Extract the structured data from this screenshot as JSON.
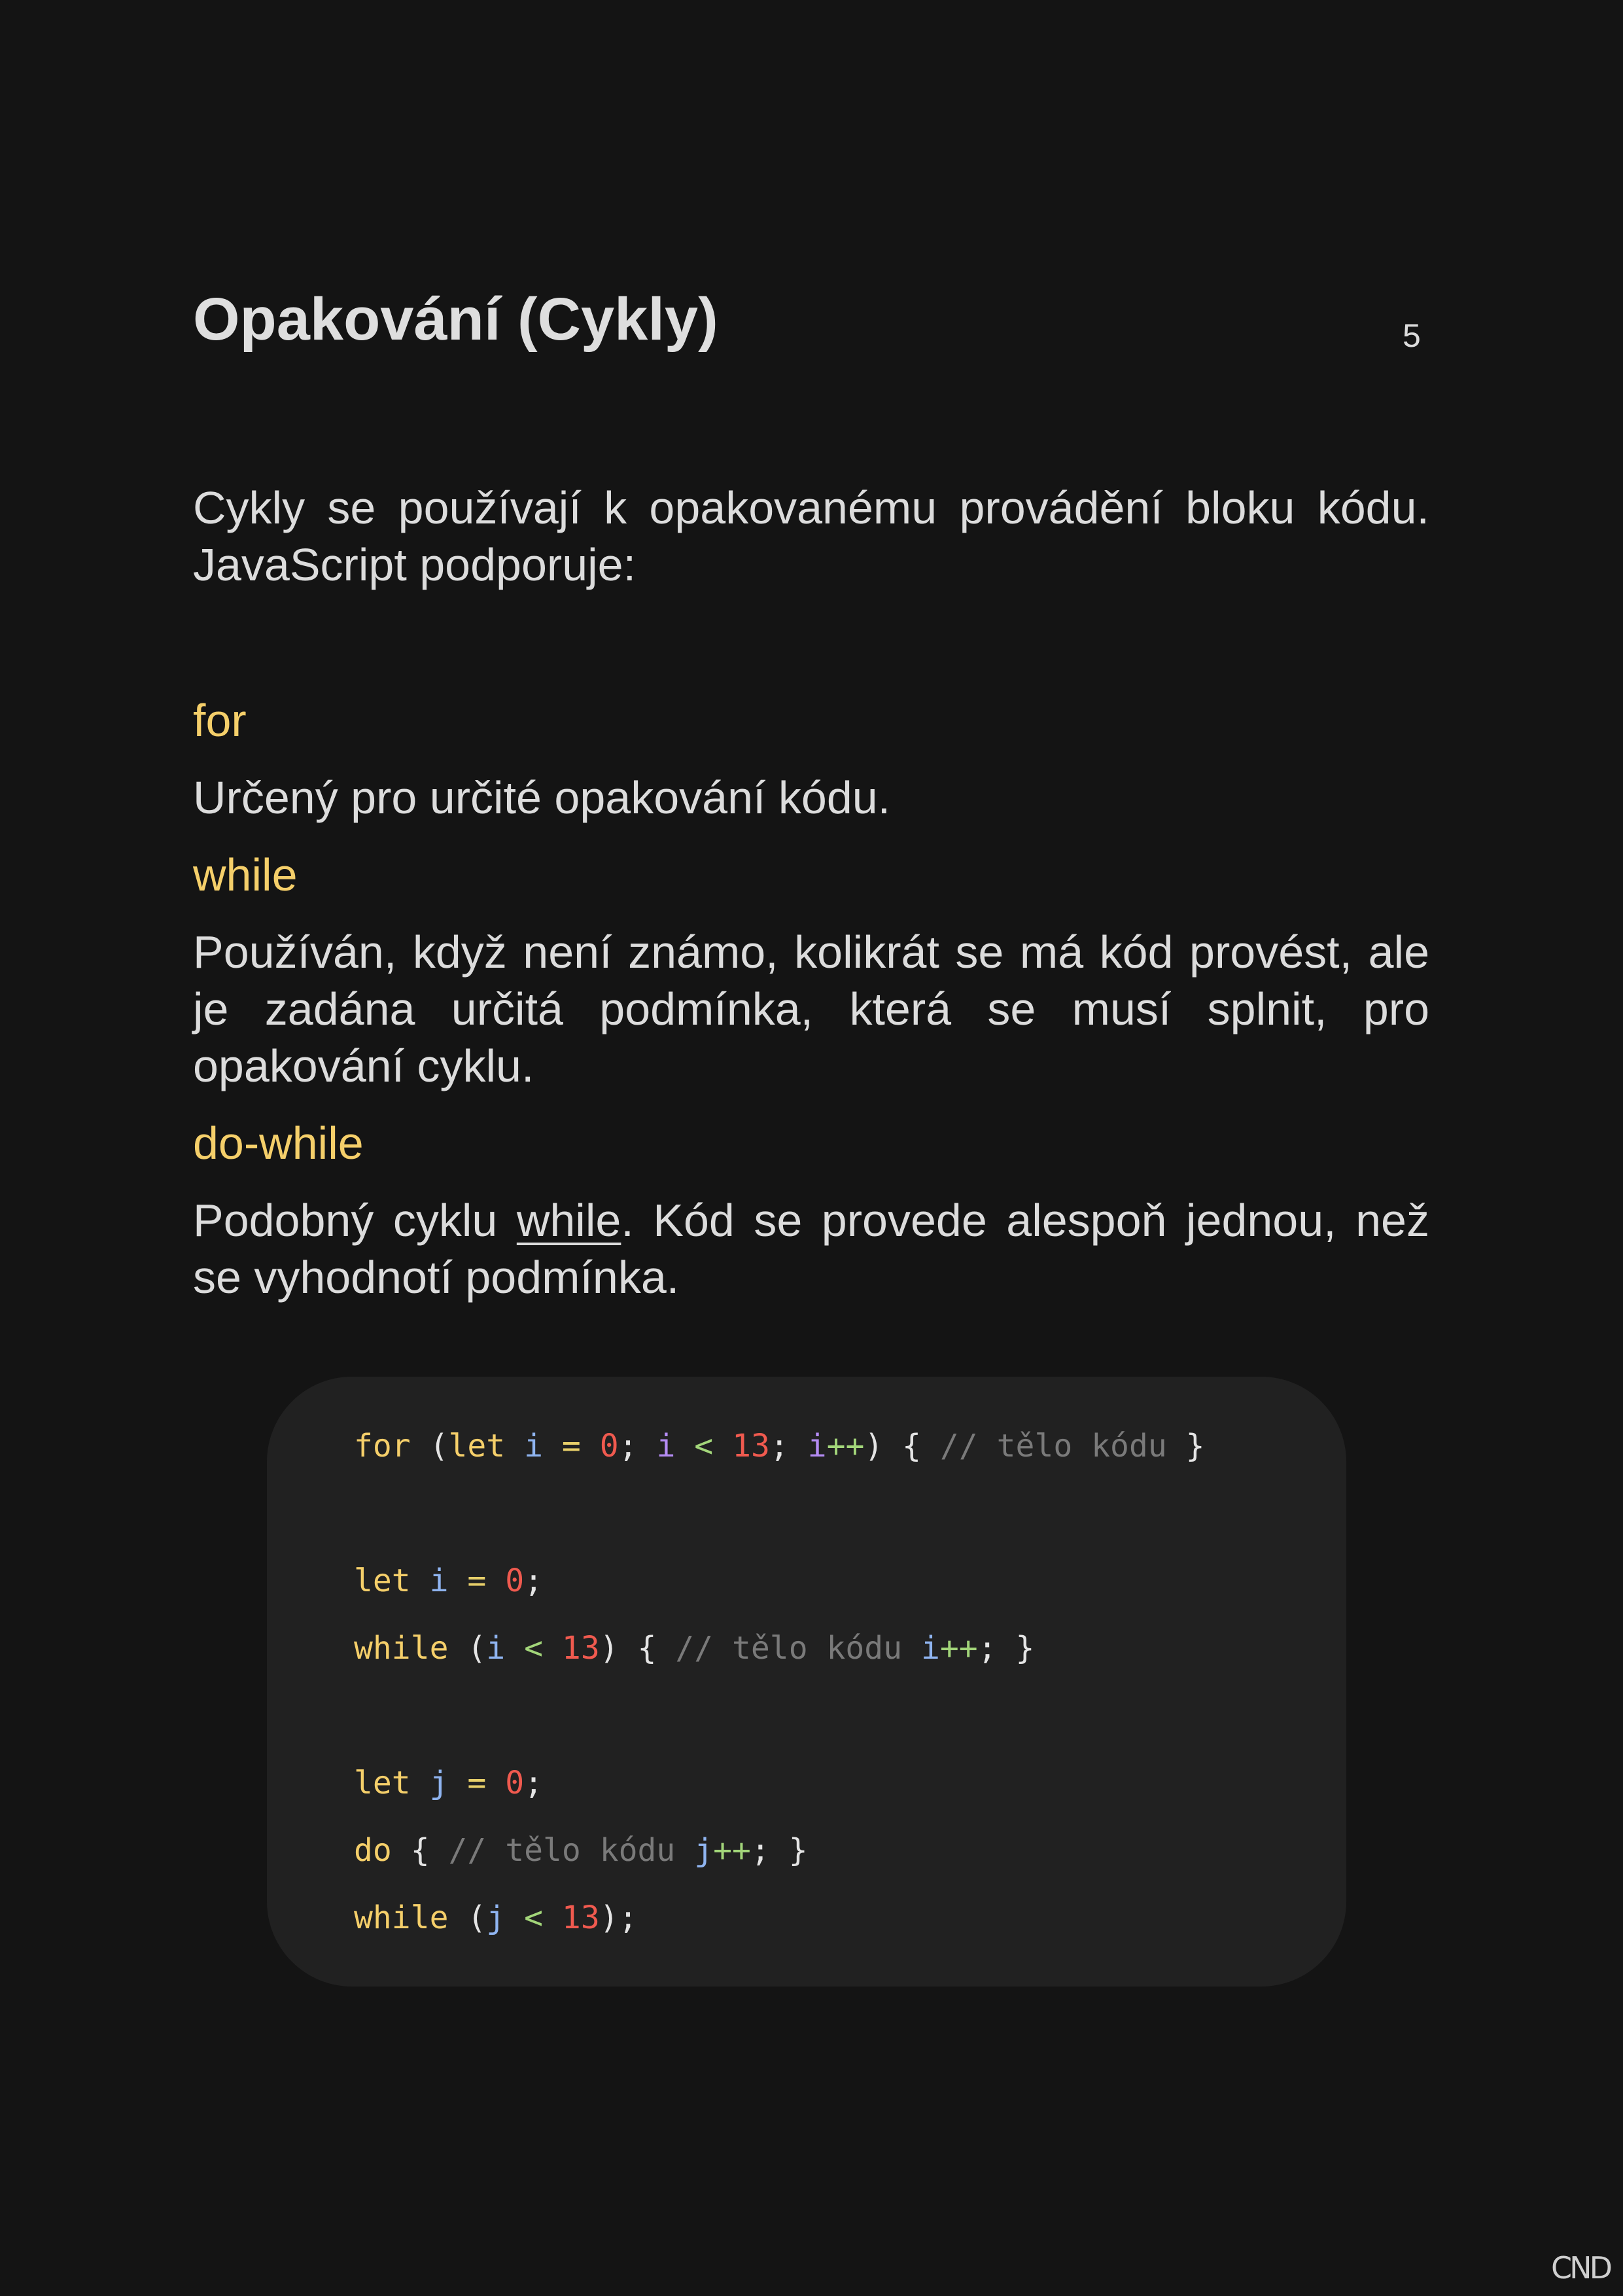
{
  "header": {
    "title": "Opakování (Cykly)",
    "page_number": "5"
  },
  "intro": "Cykly se používají k opakovanému provádění bloku kódu. JavaScript podporuje:",
  "loops": [
    {
      "term": "for",
      "description": "Určený pro určité opakování kódu."
    },
    {
      "term": "while",
      "description": "Používán, když není známo, kolikrát se má kód provést, ale je zadána určitá podmínka, která se musí splnit, pro opakování cyklu."
    },
    {
      "term": "do-while",
      "description_before": "Podobný cyklu ",
      "description_link": "while",
      "description_after": ". Kód se provede alespoň jednou, než se vyhodnotí podmínka."
    }
  ],
  "code": {
    "lines": [
      [
        [
          "kw",
          "for"
        ],
        [
          "pl",
          " ("
        ],
        [
          "kw",
          "let"
        ],
        [
          "pl",
          " "
        ],
        [
          "var",
          "i"
        ],
        [
          "pl",
          " "
        ],
        [
          "op",
          "="
        ],
        [
          "pl",
          " "
        ],
        [
          "num",
          "0"
        ],
        [
          "pl",
          "; "
        ],
        [
          "var2",
          "i"
        ],
        [
          "pl",
          " "
        ],
        [
          "opg",
          "<"
        ],
        [
          "pl",
          " "
        ],
        [
          "num",
          "13"
        ],
        [
          "pl",
          "; "
        ],
        [
          "var2",
          "i"
        ],
        [
          "opg",
          "++"
        ],
        [
          "pl",
          ") { "
        ],
        [
          "cmt",
          "// tělo kódu"
        ],
        [
          "pl",
          " }"
        ]
      ],
      [],
      [
        [
          "kw",
          "let"
        ],
        [
          "pl",
          " "
        ],
        [
          "var",
          "i"
        ],
        [
          "pl",
          " "
        ],
        [
          "op",
          "="
        ],
        [
          "pl",
          " "
        ],
        [
          "num",
          "0"
        ],
        [
          "pl",
          ";"
        ]
      ],
      [
        [
          "kw",
          "while"
        ],
        [
          "pl",
          " ("
        ],
        [
          "var",
          "i"
        ],
        [
          "pl",
          " "
        ],
        [
          "opg",
          "<"
        ],
        [
          "pl",
          " "
        ],
        [
          "num",
          "13"
        ],
        [
          "pl",
          ") { "
        ],
        [
          "cmt",
          "// tělo kódu"
        ],
        [
          "pl",
          " "
        ],
        [
          "var",
          "i"
        ],
        [
          "opg",
          "++"
        ],
        [
          "pl",
          "; }"
        ]
      ],
      [],
      [
        [
          "kw",
          "let"
        ],
        [
          "pl",
          " "
        ],
        [
          "var",
          "j"
        ],
        [
          "pl",
          " "
        ],
        [
          "op",
          "="
        ],
        [
          "pl",
          " "
        ],
        [
          "num",
          "0"
        ],
        [
          "pl",
          ";"
        ]
      ],
      [
        [
          "kw",
          "do"
        ],
        [
          "pl",
          " { "
        ],
        [
          "cmt",
          "// tělo kódu"
        ],
        [
          "pl",
          " "
        ],
        [
          "var",
          "j"
        ],
        [
          "opg",
          "++"
        ],
        [
          "pl",
          "; }"
        ]
      ],
      [
        [
          "kw",
          "while"
        ],
        [
          "pl",
          " ("
        ],
        [
          "var",
          "j"
        ],
        [
          "pl",
          " "
        ],
        [
          "opg",
          "<"
        ],
        [
          "pl",
          " "
        ],
        [
          "num",
          "13"
        ],
        [
          "pl",
          ");"
        ]
      ]
    ]
  },
  "footer": {
    "logo_text": "CND"
  },
  "colors": {
    "background": "#141414",
    "code_background": "#212121",
    "keyword": "#f5cf6a",
    "variable": "#8fb4f0",
    "number": "#f05a4f",
    "comment": "#7a7a7a"
  }
}
